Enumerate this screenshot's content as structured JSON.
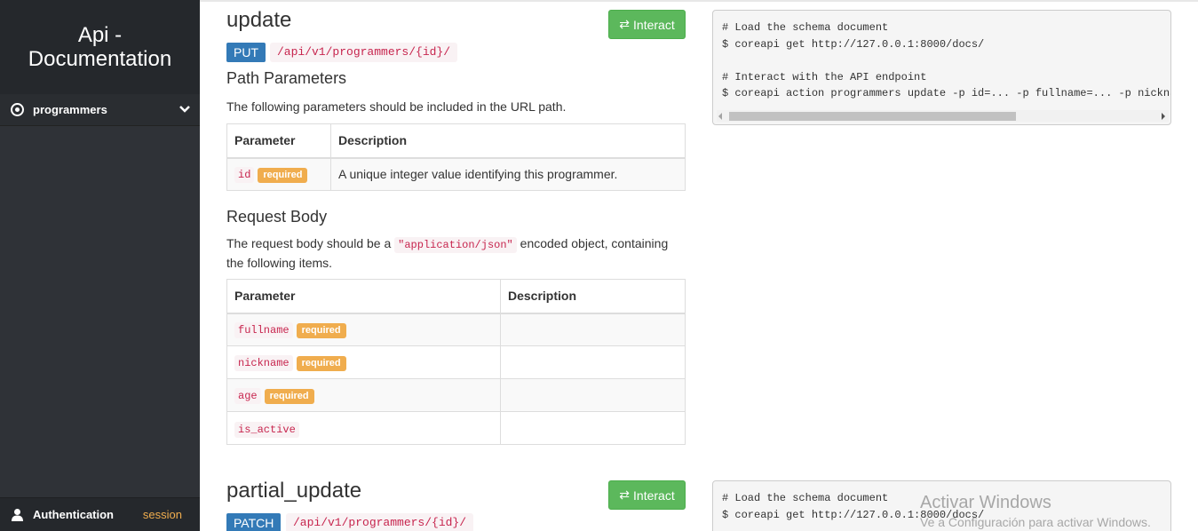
{
  "sidebar": {
    "title": "Api - Documentation",
    "items": [
      {
        "label": "programmers",
        "icon": "target-icon"
      }
    ],
    "auth": {
      "label": "Authentication",
      "value": "session"
    }
  },
  "endpoints": [
    {
      "name": "update",
      "method": "PUT",
      "path": "/api/v1/programmers/{id}/",
      "interact_label": "Interact",
      "path_params_heading": "Path Parameters",
      "path_params_text": "The following parameters should be included in the URL path.",
      "path_params_headers": [
        "Parameter",
        "Description"
      ],
      "path_params": [
        {
          "name": "id",
          "badge": "required",
          "description": "A unique integer value identifying this programmer."
        }
      ],
      "body_heading": "Request Body",
      "body_text_before": "The request body should be a ",
      "body_text_code": "\"application/json\"",
      "body_text_after": " encoded object, containing the following items.",
      "body_headers": [
        "Parameter",
        "Description"
      ],
      "body_params": [
        {
          "name": "fullname",
          "badge": "required",
          "description": ""
        },
        {
          "name": "nickname",
          "badge": "required",
          "description": ""
        },
        {
          "name": "age",
          "badge": "required",
          "description": ""
        },
        {
          "name": "is_active",
          "badge": "",
          "description": ""
        }
      ],
      "code_lines": [
        "# Load the schema document",
        "$ coreapi get http://127.0.0.1:8000/docs/",
        "",
        "# Interact with the API endpoint",
        "$ coreapi action programmers update -p id=... -p fullname=... -p nickname=... -p age=... -p is_active=..."
      ]
    },
    {
      "name": "partial_update",
      "method": "PATCH",
      "path": "/api/v1/programmers/{id}/",
      "interact_label": "Interact",
      "code_lines": [
        "# Load the schema document",
        "$ coreapi get http://127.0.0.1:8000/docs/"
      ]
    }
  ],
  "watermark": {
    "title": "Activar Windows",
    "subtitle": "Ve a Configuración para activar Windows."
  },
  "colors": {
    "sidebar_bg": "#2f3237",
    "method_blue": "#337ab7",
    "interact_green": "#5cb85c",
    "required_orange": "#f0ad4e",
    "code_red": "#c7254e"
  }
}
